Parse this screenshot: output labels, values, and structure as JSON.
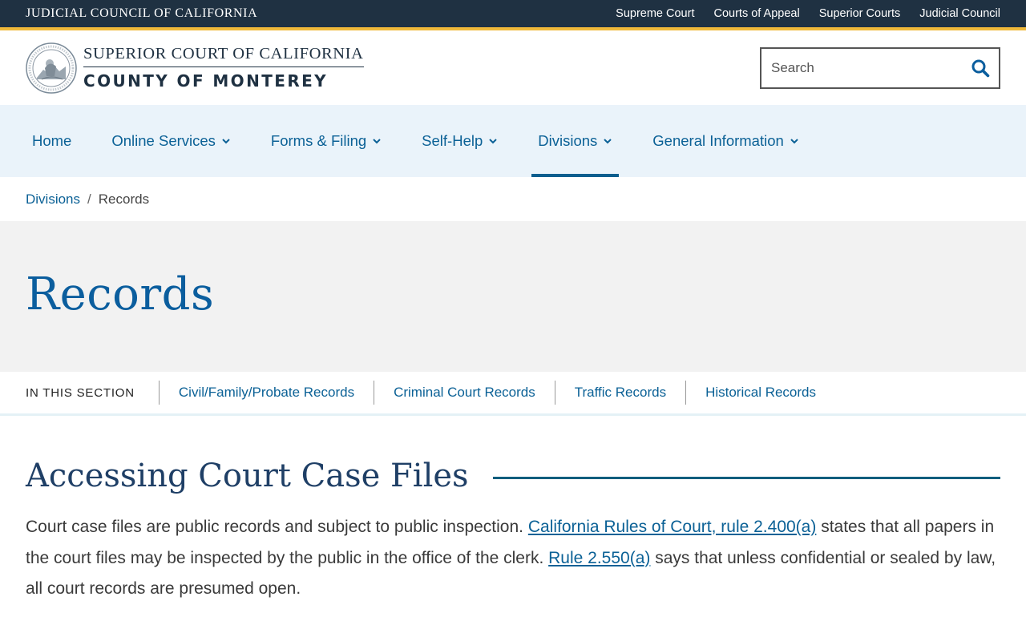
{
  "topbar": {
    "brand": "JUDICIAL COUNCIL OF CALIFORNIA",
    "links": [
      "Supreme Court",
      "Courts of Appeal",
      "Superior Courts",
      "Judicial Council"
    ]
  },
  "header": {
    "logo_line1": "SUPERIOR COURT OF CALIFORNIA",
    "logo_line2": "COUNTY OF MONTEREY",
    "search_placeholder": "Search"
  },
  "nav": {
    "items": [
      {
        "label": "Home"
      },
      {
        "label": "Online Services"
      },
      {
        "label": "Forms & Filing"
      },
      {
        "label": "Self-Help"
      },
      {
        "label": "Divisions"
      },
      {
        "label": "General Information"
      }
    ],
    "active": "Divisions"
  },
  "breadcrumb": {
    "parent": "Divisions",
    "separator": "/",
    "current": "Records"
  },
  "hero": {
    "title": "Records"
  },
  "section_nav": {
    "label": "IN THIS SECTION",
    "links": [
      "Civil/Family/Probate Records",
      "Criminal Court Records",
      "Traffic Records",
      "Historical Records"
    ]
  },
  "content": {
    "heading": "Accessing Court Case Files",
    "para_part1": "Court case files are public records and subject to public inspection. ",
    "link1": "California Rules of Court, rule 2.400(a)",
    "para_part2": " states that all papers in the court files may be inspected by the public in the office of the clerk. ",
    "link2": "Rule 2.550(a)",
    "para_part3": " says that unless confidential or sealed by law, all court records are presumed open."
  },
  "colors": {
    "topbar_bg": "#1f3142",
    "gold": "#f0b93a",
    "link_blue": "#0b6196",
    "nav_bg": "#eaf3fa",
    "hero_bg": "#f2f2f2"
  }
}
